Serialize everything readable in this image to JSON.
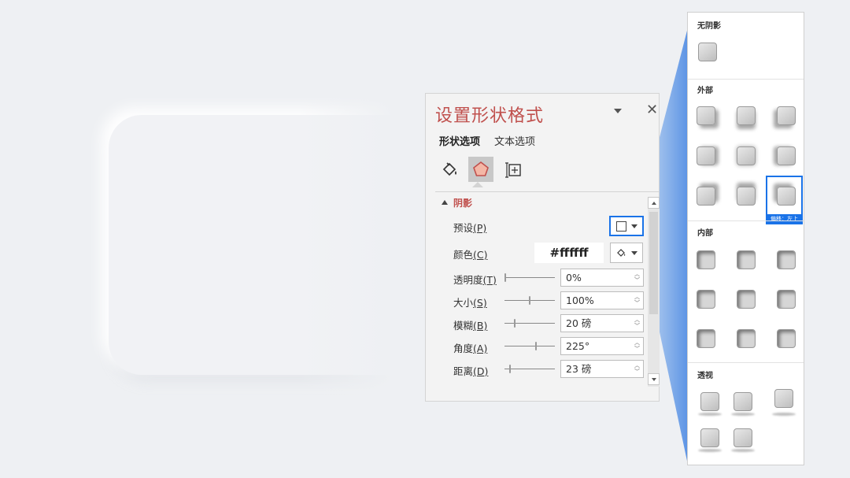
{
  "panel": {
    "title": "设置形状格式",
    "close_label": "✕",
    "tabs": [
      {
        "label": "形状选项",
        "active": true
      },
      {
        "label": "文本选项",
        "active": false
      }
    ],
    "icons": [
      "fill-line-icon",
      "effects-icon",
      "size-properties-icon"
    ],
    "section": {
      "title": "阴影",
      "preset_label": "预设",
      "preset_key": "(P)",
      "color_label": "颜色",
      "color_key": "(C)",
      "color_value": "#ffffff",
      "rows": [
        {
          "label": "透明度",
          "key": "(T)",
          "value": "0%",
          "slider": 0.0
        },
        {
          "label": "大小",
          "key": "(S)",
          "value": "100%",
          "slider": 0.5
        },
        {
          "label": "模糊",
          "key": "(B)",
          "value": "20 磅",
          "slider": 0.2
        },
        {
          "label": "角度",
          "key": "(A)",
          "value": "225°",
          "slider": 0.63
        },
        {
          "label": "距离",
          "key": "(D)",
          "value": "23 磅",
          "slider": 0.1
        }
      ]
    }
  },
  "gallery": {
    "no_shadow": "无阴影",
    "outer": "外部",
    "inner": "内部",
    "perspective": "透视",
    "selected_tip": "偏移：左上"
  },
  "colors": {
    "accent_red": "#c0504d",
    "accent_blue": "#1a73e8"
  }
}
